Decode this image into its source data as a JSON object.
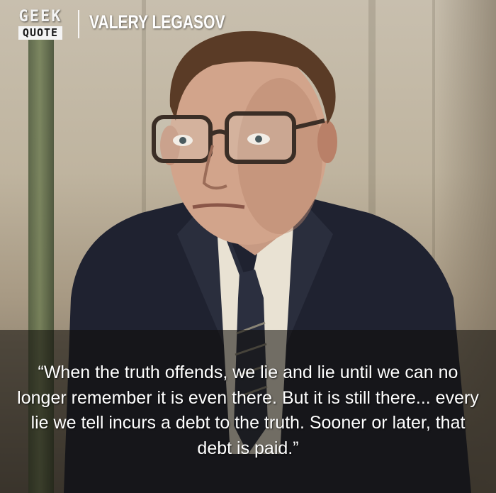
{
  "brand": {
    "top": "GEEK",
    "bottom": "QUOTE"
  },
  "header": {
    "name": "VALERY LEGASOV"
  },
  "quote": {
    "text": "“When the truth offends, we lie and lie until we can no longer remember it is even there. But it is still there... every lie we tell incurs a debt to the truth. Sooner or later, that debt is paid.”"
  },
  "colors": {
    "band": "#0f0c0a",
    "text": "#ffffff",
    "backdrop": "#c8bfae"
  }
}
